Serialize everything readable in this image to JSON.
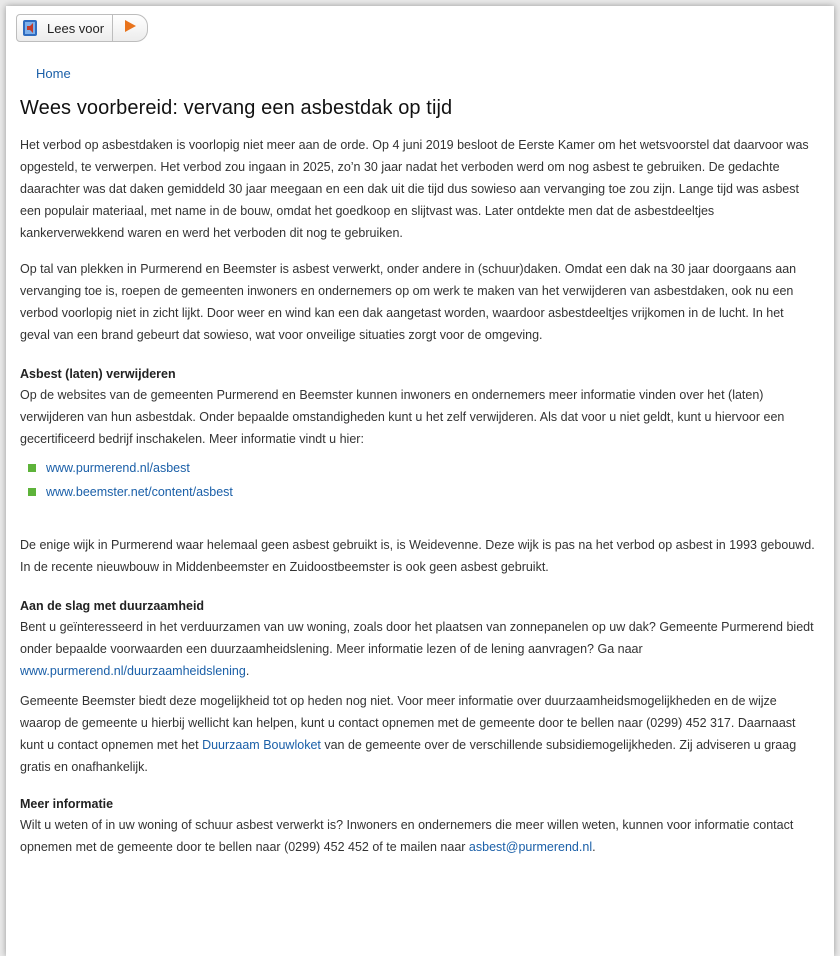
{
  "toolbar": {
    "read_aloud_label": "Lees voor"
  },
  "breadcrumb": {
    "home": "Home"
  },
  "page": {
    "title": "Wees voorbereid: vervang een asbestdak op tijd",
    "intro": "Het verbod op asbestdaken is voorlopig niet meer aan de orde. Op 4 juni 2019 besloot de Eerste Kamer om het wetsvoorstel dat daarvoor was opgesteld, te verwerpen. Het verbod zou ingaan in 2025, zo’n 30 jaar nadat het verboden werd om nog asbest te gebruiken. De gedachte daarachter was dat daken gemiddeld 30 jaar meegaan en een dak uit die tijd dus sowieso aan vervanging toe zou zijn. Lange tijd was asbest een populair materiaal, met name in de bouw, omdat het goedkoop en slijtvast was. Later ontdekte men dat de asbestdeeltjes kankerverwekkend waren en werd het verboden dit nog te gebruiken.",
    "para2": "Op tal van plekken in Purmerend en Beemster is asbest verwerkt, onder andere in (schuur)daken. Omdat een dak na 30 jaar doorgaans aan vervanging toe is, roepen de gemeenten inwoners en ondernemers op om werk te maken van het verwijderen van asbestdaken, ook nu een verbod voorlopig niet in zicht lijkt. Door weer en wind kan een dak aangetast worden, waardoor asbestdeeltjes vrijkomen in de lucht. In het geval van een brand gebeurt dat sowieso, wat voor onveilige situaties zorgt voor de omgeving.",
    "section1": {
      "heading": "Asbest (laten) verwijderen",
      "text": "Op de websites van de gemeenten Purmerend en Beemster kunnen inwoners en ondernemers meer informatie vinden over het (laten) verwijderen van hun asbestdak. Onder bepaalde omstandigheden kunt u het zelf verwijderen. Als dat voor u niet geldt, kunt u hiervoor een gecertificeerd bedrijf inschakelen. Meer informatie vindt u hier:",
      "links": [
        "www.purmerend.nl/asbest",
        "www.beemster.net/content/asbest"
      ]
    },
    "para3": "De enige wijk in Purmerend waar helemaal geen asbest gebruikt is, is Weidevenne. Deze wijk is pas na het verbod op asbest in 1993 gebouwd. In de recente nieuwbouw in Middenbeemster en Zuidoostbeemster is ook geen asbest gebruikt.",
    "section2": {
      "heading": "Aan de slag met duurzaamheid",
      "text": "Bent u geïnteresseerd in het verduurzamen van uw woning, zoals door het plaatsen van zonnepanelen op uw dak? Gemeente Purmerend biedt onder bepaalde voorwaarden een duurzaamheidslening. Meer informatie lezen of de lening aanvragen? Ga naar ",
      "link": "www.purmerend.nl/duurzaamheidslening",
      "after_link": ".",
      "text2_before": "Gemeente Beemster biedt deze mogelijkheid tot op heden nog niet. Voor meer informatie over duurzaamheidsmogelijkheden en de wijze waarop de gemeente u hierbij wellicht kan helpen, kunt u contact opnemen met de gemeente door te bellen naar (0299) 452 317. Daarnaast kunt u contact opnemen met het ",
      "text2_link": "Duurzaam Bouwloket",
      "text2_after": " van de gemeente over de verschillende subsidiemogelijkheden. Zij adviseren u graag gratis en onafhankelijk."
    },
    "section3": {
      "heading": "Meer informatie",
      "text": "Wilt u weten of in uw woning of schuur asbest verwerkt is? Inwoners en ondernemers die meer willen weten, kunnen voor informatie contact opnemen met de gemeente door te bellen naar (0299) 452 452 of te mailen naar ",
      "email": "asbest@purmerend.nl",
      "after": "."
    }
  },
  "colors": {
    "link": "#1a5fa8",
    "bullet": "#5db33a",
    "play": "#e8731c"
  }
}
